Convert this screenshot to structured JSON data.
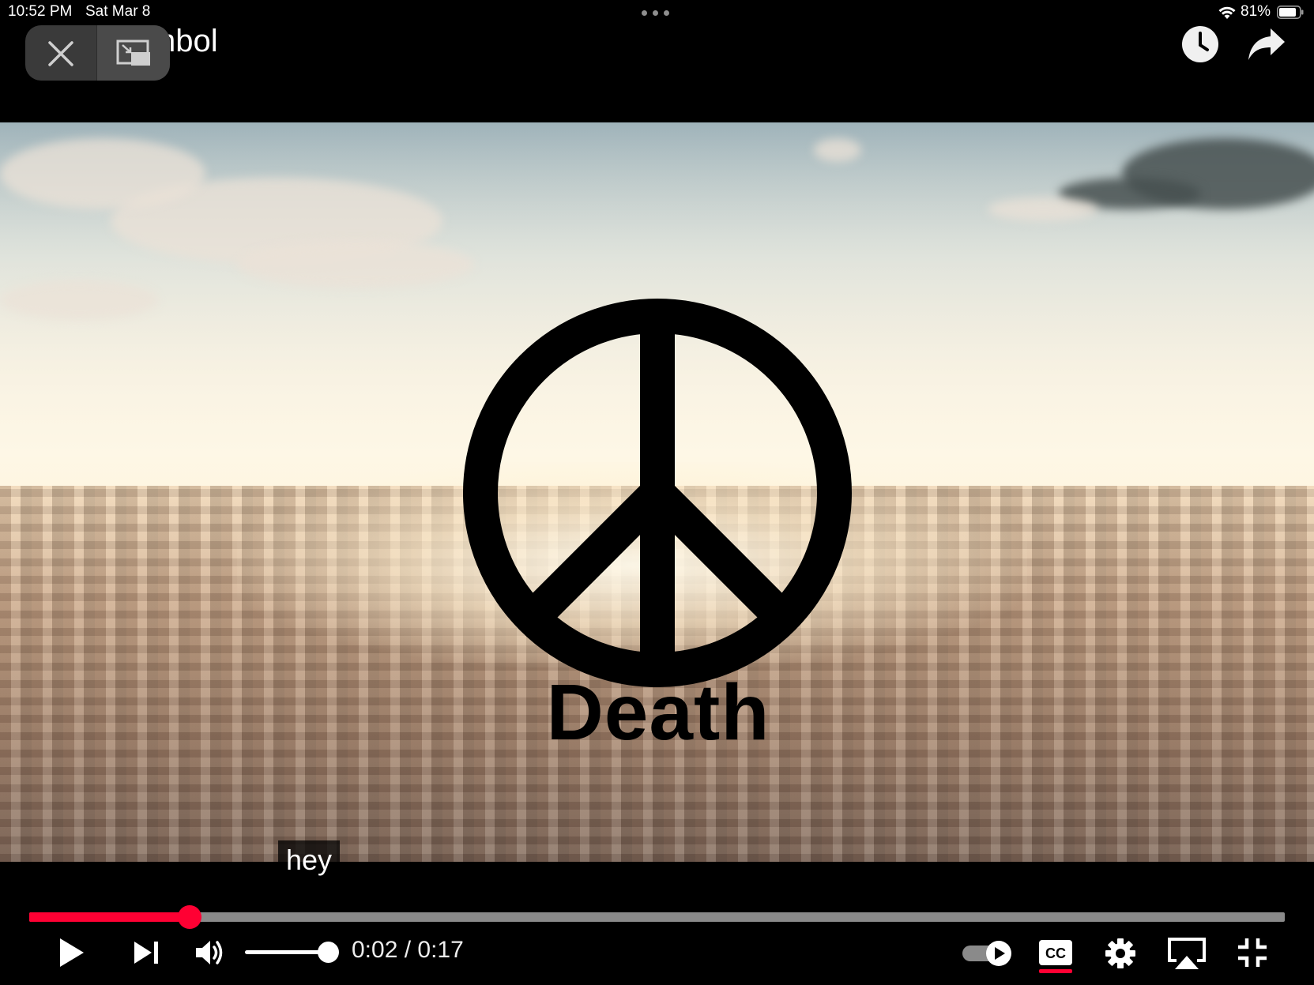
{
  "status_bar": {
    "time": "10:52 PM",
    "date": "Sat Mar 8",
    "battery_percent": "81%"
  },
  "video": {
    "title_visible": "nbol",
    "on_screen_caption": "Death",
    "subtitle": "hey"
  },
  "player": {
    "current_time": "0:02",
    "separator": " / ",
    "duration": "0:17",
    "progress_fraction": 0.128,
    "volume_fraction": 0.9
  },
  "colors": {
    "progress": "#ff0033",
    "background": "#000000"
  },
  "icons": {
    "close": "close-icon",
    "pip_restore": "pip-restore-icon",
    "watch_later": "clock-icon",
    "share": "share-arrow-icon",
    "play": "play-icon",
    "next": "skip-next-icon",
    "volume": "volume-icon",
    "autoplay": "autoplay-toggle-icon",
    "captions": "cc-icon",
    "settings": "gear-icon",
    "airplay": "airplay-icon",
    "exit_fullscreen": "exit-fullscreen-icon"
  }
}
